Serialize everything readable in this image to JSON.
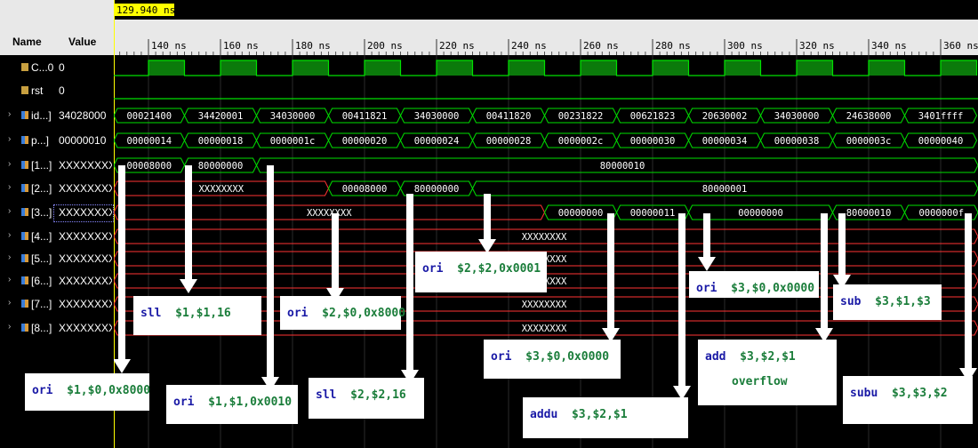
{
  "cursor_time": "129.940 ns",
  "header": {
    "name_label": "Name",
    "value_label": "Value"
  },
  "timeline_ticks": [
    "140 ns",
    "160 ns",
    "180 ns",
    "200 ns",
    "220 ns",
    "240 ns",
    "260 ns",
    "280 ns",
    "300 ns",
    "320 ns",
    "340 ns",
    "360 ns"
  ],
  "signals": [
    {
      "name": "C...0",
      "value": "0",
      "kind": "bit",
      "expand": false
    },
    {
      "name": "rst",
      "value": "0",
      "kind": "bit",
      "expand": false
    },
    {
      "name": "id...]",
      "value": "34028000",
      "kind": "bus",
      "expand": true
    },
    {
      "name": "p...]",
      "value": "00000010",
      "kind": "bus",
      "expand": true
    },
    {
      "name": "[1...]",
      "value": "XXXXXXXX",
      "kind": "bus",
      "expand": true
    },
    {
      "name": "[2...]",
      "value": "XXXXXXXX",
      "kind": "bus",
      "expand": true
    },
    {
      "name": "[3...]",
      "value": "XXXXXXXX",
      "kind": "bus",
      "expand": true
    },
    {
      "name": "[4...]",
      "value": "XXXXXXXX",
      "kind": "bus",
      "expand": true
    },
    {
      "name": "[5...]",
      "value": "XXXXXXXX",
      "kind": "bus",
      "expand": true
    },
    {
      "name": "[6...]",
      "value": "XXXXXXXX",
      "kind": "bus",
      "expand": true
    },
    {
      "name": "[7...]",
      "value": "XXXXXXXX",
      "kind": "bus",
      "expand": true
    },
    {
      "name": "[8...]",
      "value": "XXXXXXXX",
      "kind": "bus",
      "expand": true
    }
  ],
  "bus_waves": {
    "id": [
      "00021400",
      "34420001",
      "34030000",
      "00411821",
      "34030000",
      "00411820",
      "00231822",
      "00621823",
      "20630002",
      "34030000",
      "24638000",
      "3401ffff"
    ],
    "pc": [
      "00000014",
      "00000018",
      "0000001c",
      "00000020",
      "00000024",
      "00000028",
      "0000002c",
      "00000030",
      "00000034",
      "00000038",
      "0000003c",
      "00000040"
    ],
    "r1": [
      "00008000",
      "80000000",
      "80000010"
    ],
    "r2": [
      "XXXXXXXX",
      "00008000",
      "80000000",
      "80000001"
    ],
    "r3": [
      "XXXXXXXX",
      "00000000",
      "00000011",
      "00000000",
      "80000010",
      "0000000f"
    ],
    "xfill": "XXXXXXXX"
  },
  "annotations": [
    {
      "kw": "ori",
      "ops": "$1,$0,0x8000"
    },
    {
      "kw": "sll",
      "ops": "$1,$1,16"
    },
    {
      "kw": "ori",
      "ops": "$1,$1,0x0010"
    },
    {
      "kw": "ori",
      "ops": "$2,$0,0x8000"
    },
    {
      "kw": "sll",
      "ops": "$2,$2,16"
    },
    {
      "kw": "ori",
      "ops": "$2,$2,0x0001"
    },
    {
      "kw": "ori",
      "ops": "$3,$0,0x0000"
    },
    {
      "kw": "addu",
      "ops": "$3,$2,$1"
    },
    {
      "kw": "ori",
      "ops": "$3,$0,0x0000"
    },
    {
      "kw": "add",
      "ops": "$3,$2,$1",
      "note": "overflow"
    },
    {
      "kw": "sub",
      "ops": "$3,$1,$3"
    },
    {
      "kw": "subu",
      "ops": "$3,$3,$2"
    }
  ],
  "colors": {
    "wave": "#00e000",
    "bus_x": "#ff3333",
    "cursor": "#ffff00",
    "clk_fill": "#0b7a0b"
  }
}
